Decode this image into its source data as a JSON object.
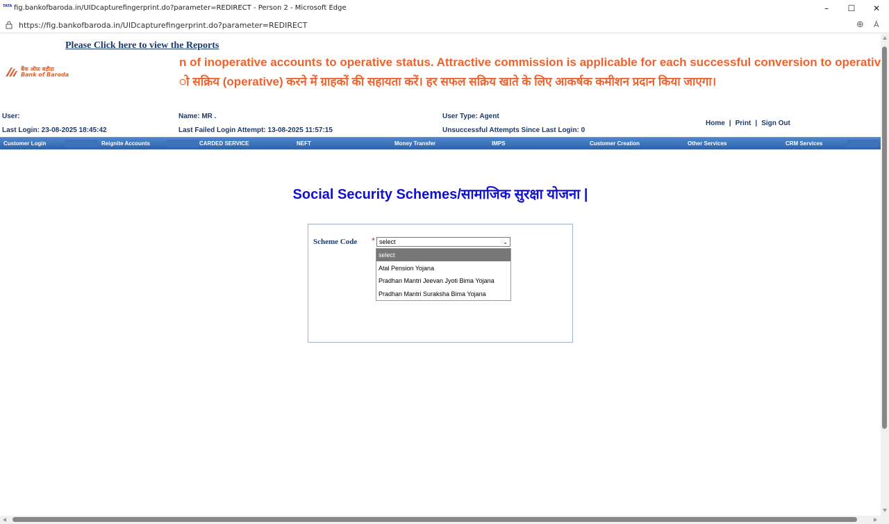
{
  "browser": {
    "title": "fig.bankofbaroda.in/UIDcapturefingerprint.do?parameter=REDIRECT - Person 2 - Microsoft Edge",
    "url": "https://fig.bankofbaroda.in/UIDcapturefingerprint.do?parameter=REDIRECT",
    "favicon_text": "TATA"
  },
  "header": {
    "reports_link": "Please Click here to view the Reports",
    "logo_hindi": "बैंक ऑफ़ बड़ौदा",
    "logo_english": "Bank of Baroda",
    "marquee_line1": "n of inoperative accounts to operative status. Attractive commission is applicable for each successful conversion to operative",
    "marquee_line2": "ो सक्रिय (operative) करने में ग्राहकों की सहायता करें। हर सफल सक्रिय खाते के लिए आकर्षक कमीशन प्रदान किया जाएगा।"
  },
  "user_info": {
    "user": "User:",
    "name": "Name:  MR .",
    "user_type": "User Type:  Agent",
    "last_login": "Last Login: 23-08-2025 18:45:42",
    "last_failed": "Last Failed Login Attempt:  13-08-2025 11:57:15",
    "unsuccessful": "Unsuccessful Attempts Since Last Login: 0"
  },
  "top_links": {
    "home": "Home",
    "print": "Print",
    "signout": "Sign Out",
    "separator": "|"
  },
  "nav": {
    "items": [
      "Customer Login",
      "Reignite Accounts",
      "CARDED SERVICE",
      "NEFT",
      "Money Transfer",
      "IMPS",
      "Customer Creation",
      "Other Services",
      "CRM Services"
    ]
  },
  "main": {
    "title": "Social Security Schemes/सामाजिक सुरक्षा योजना |",
    "scheme_label": "Scheme Code",
    "required_mark": "*",
    "select_value": "select",
    "options": [
      "select",
      "Atal Pension Yojana",
      "Pradhan Mantri Jeevan Jyoti Bima Yojana",
      "Pradhan Mantri Suraksha Bima Yojana"
    ]
  },
  "colors": {
    "accent_orange": "#f0622d",
    "nav_blue": "#2d62ab",
    "title_blue": "#1010d0",
    "label_navy": "#1a3a6e"
  }
}
